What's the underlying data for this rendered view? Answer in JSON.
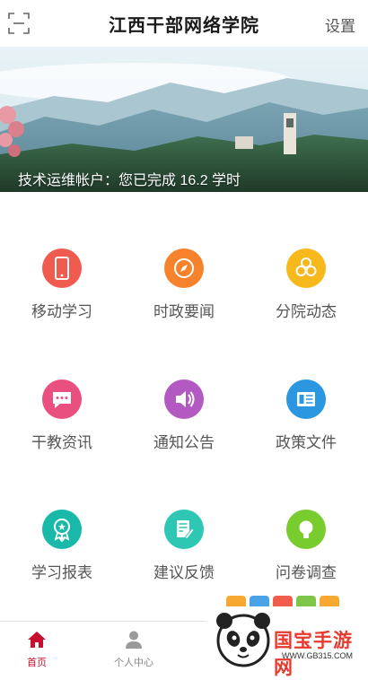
{
  "header": {
    "title": "江西干部网络学院",
    "settings_label": "设置"
  },
  "banner": {
    "caption": "技术运维帐户：您已完成 16.2 学时"
  },
  "menu": [
    {
      "label": "移动学习",
      "icon": "phone-icon",
      "color": "#ef5b4f"
    },
    {
      "label": "时政要闻",
      "icon": "compass-icon",
      "color": "#f6832b"
    },
    {
      "label": "分院动态",
      "icon": "hexagons-icon",
      "color": "#f7b81c"
    },
    {
      "label": "干教资讯",
      "icon": "chat-icon",
      "color": "#e9507f"
    },
    {
      "label": "通知公告",
      "icon": "speaker-icon",
      "color": "#b35ac2"
    },
    {
      "label": "政策文件",
      "icon": "document-icon",
      "color": "#2a97e0"
    },
    {
      "label": "学习报表",
      "icon": "badge-icon",
      "color": "#18b9a8"
    },
    {
      "label": "建议反馈",
      "icon": "edit-icon",
      "color": "#2ec7b4"
    },
    {
      "label": "问卷调查",
      "icon": "bulb-icon",
      "color": "#79cc2d"
    }
  ],
  "tabbar": {
    "home_label": "首页",
    "profile_label": "个人中心",
    "active_color": "#c8102e"
  },
  "watermark": {
    "text": "国宝手游网",
    "url": "WWW.GB315.COM"
  }
}
